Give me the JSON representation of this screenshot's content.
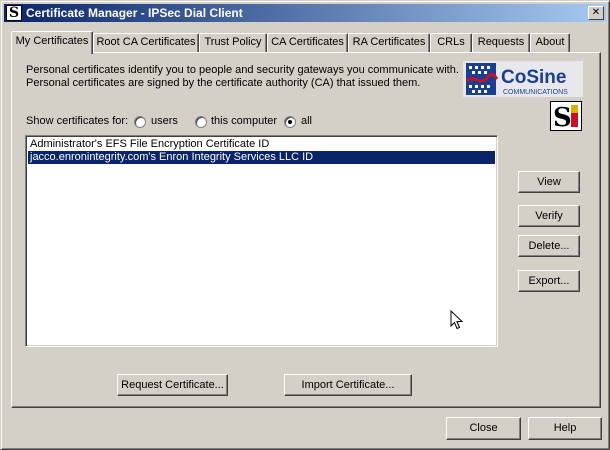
{
  "window": {
    "title": "Certificate Manager - IPSec Dial Client",
    "app_icon_letter": "S"
  },
  "tabs": [
    {
      "label": "My Certificates",
      "active": true
    },
    {
      "label": "Root CA Certificates"
    },
    {
      "label": "Trust Policy"
    },
    {
      "label": "CA Certificates"
    },
    {
      "label": "RA Certificates"
    },
    {
      "label": "CRLs"
    },
    {
      "label": "Requests"
    },
    {
      "label": "About"
    }
  ],
  "description": {
    "line1": "Personal certificates identify you to people and security gateways you communicate with.",
    "line2": "Personal certificates are signed by the certificate authority (CA) that issued them."
  },
  "logo": {
    "name": "CoSine",
    "tagline": "COMMUNICATIONS"
  },
  "show_for": {
    "label": "Show certificates for:",
    "options": [
      {
        "label": "users",
        "checked": false
      },
      {
        "label": "this computer",
        "checked": false
      },
      {
        "label": "all",
        "checked": true
      }
    ]
  },
  "certificates": [
    {
      "name": "Administrator's EFS File Encryption Certificate ID",
      "selected": false
    },
    {
      "name": "jacco.enronintegrity.com's Enron Integrity Services LLC ID",
      "selected": true
    }
  ],
  "side_buttons": {
    "view": "View",
    "verify": "Verify",
    "delete": "Delete...",
    "export": "Export..."
  },
  "bottom_buttons": {
    "request": "Request Certificate...",
    "import": "Import Certificate..."
  },
  "footer": {
    "close": "Close",
    "help": "Help"
  },
  "colors": {
    "title_bar": "#0a246a",
    "selection": "#0a246a",
    "face": "#d4d0c8",
    "logo_blue": "#1a3f8f",
    "logo_red": "#c8102e"
  }
}
